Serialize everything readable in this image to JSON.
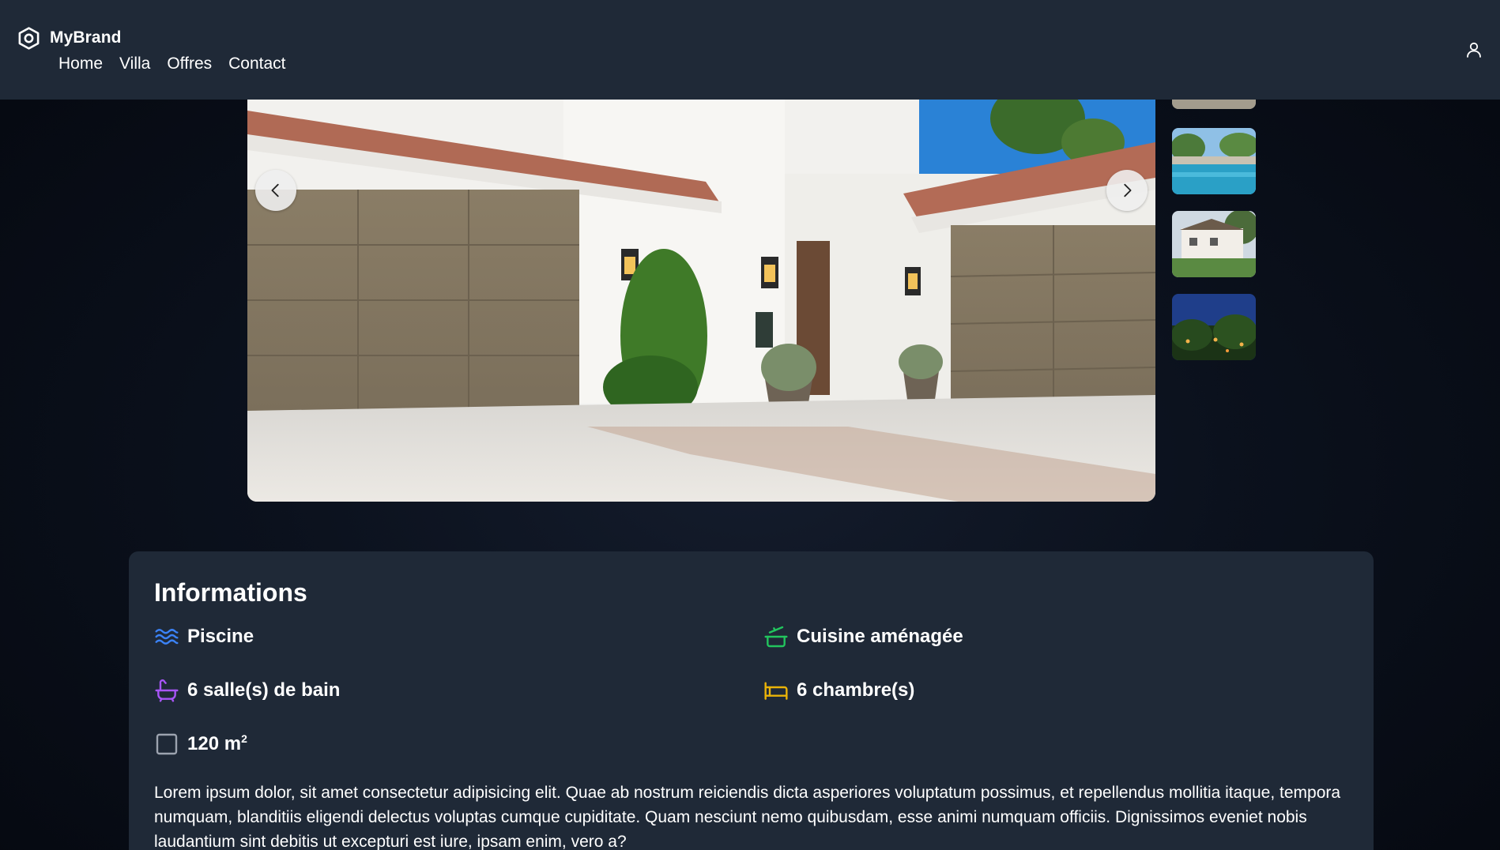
{
  "header": {
    "brand": "MyBrand",
    "nav": [
      "Home",
      "Villa",
      "Offres",
      "Contact"
    ]
  },
  "gallery": {
    "thumbnails": [
      "stone-wall-thumbnail",
      "pool-thumbnail",
      "villa-facade-thumbnail",
      "night-garden-thumbnail"
    ]
  },
  "info": {
    "title": "Informations",
    "features": {
      "pool": "Piscine",
      "kitchen": "Cuisine aménagée",
      "bathrooms": "6 salle(s) de bain",
      "bedrooms": "6 chambre(s)",
      "area_value": "120 m",
      "area_exp": "2"
    },
    "description": "Lorem ipsum dolor, sit amet consectetur adipisicing elit. Quae ab nostrum reiciendis dicta asperiores voluptatum possimus, et repellendus mollitia itaque, tempora numquam, blanditiis eligendi delectus voluptas cumque cupiditate. Quam nesciunt nemo quibusdam, esse animi numquam officiis. Dignissimos eveniet nobis laudantium sint debitis ut excepturi est iure, ipsam enim, vero a?"
  },
  "colors": {
    "header_bg": "#1f2937",
    "card_bg": "#1f2937",
    "pool_icon": "#3b82f6",
    "kitchen_icon": "#22c55e",
    "bath_icon": "#a855f7",
    "bed_icon": "#eab308",
    "area_icon": "#9ca3af"
  },
  "icons": {
    "logo": "hexagon-logo-icon",
    "user": "user-icon",
    "prev": "chevron-left-icon",
    "next": "chevron-right-icon",
    "pool": "waves-icon",
    "kitchen": "cooking-pot-icon",
    "bath": "bath-icon",
    "bed": "bed-icon",
    "area": "square-icon"
  }
}
